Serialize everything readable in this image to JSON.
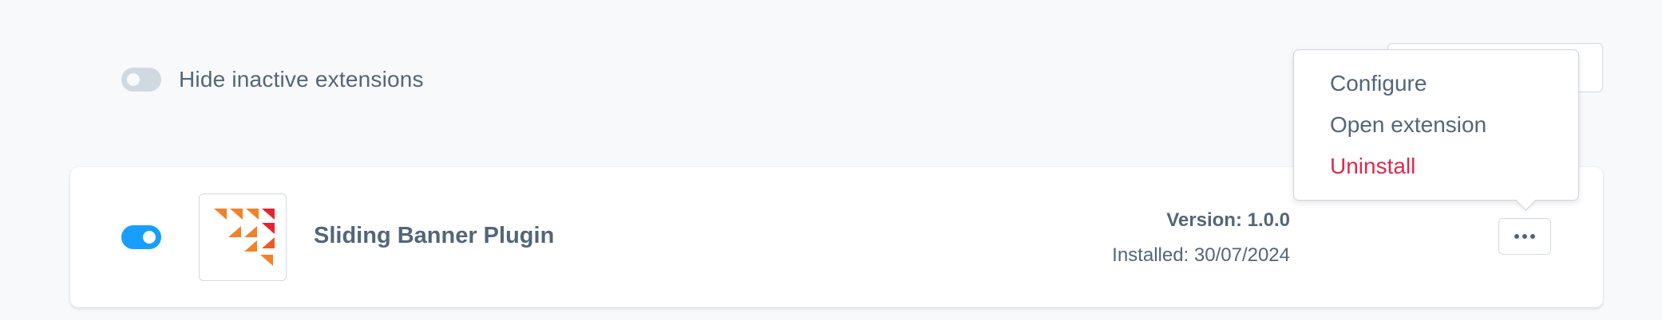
{
  "filters": {
    "hide_inactive_label": "Hide inactive extensions",
    "hide_inactive_enabled": false
  },
  "extension": {
    "name": "Sliding Banner Plugin",
    "active": true,
    "version_text": "Version: 1.0.0",
    "installed_text": "Installed: 30/07/2024",
    "icon": "triangle-pattern-logo"
  },
  "context_menu": {
    "items": [
      {
        "label": "Configure"
      },
      {
        "label": "Open extension"
      },
      {
        "label": "Uninstall"
      }
    ]
  },
  "colors": {
    "toggle_on": "#189eff",
    "toggle_off": "#d1d9e0",
    "text": "#52667a",
    "danger": "#de294c",
    "logo_orange": "#f0832a",
    "logo_red": "#e8232e"
  },
  "icons": {
    "more_actions": "ellipsis-icon"
  }
}
